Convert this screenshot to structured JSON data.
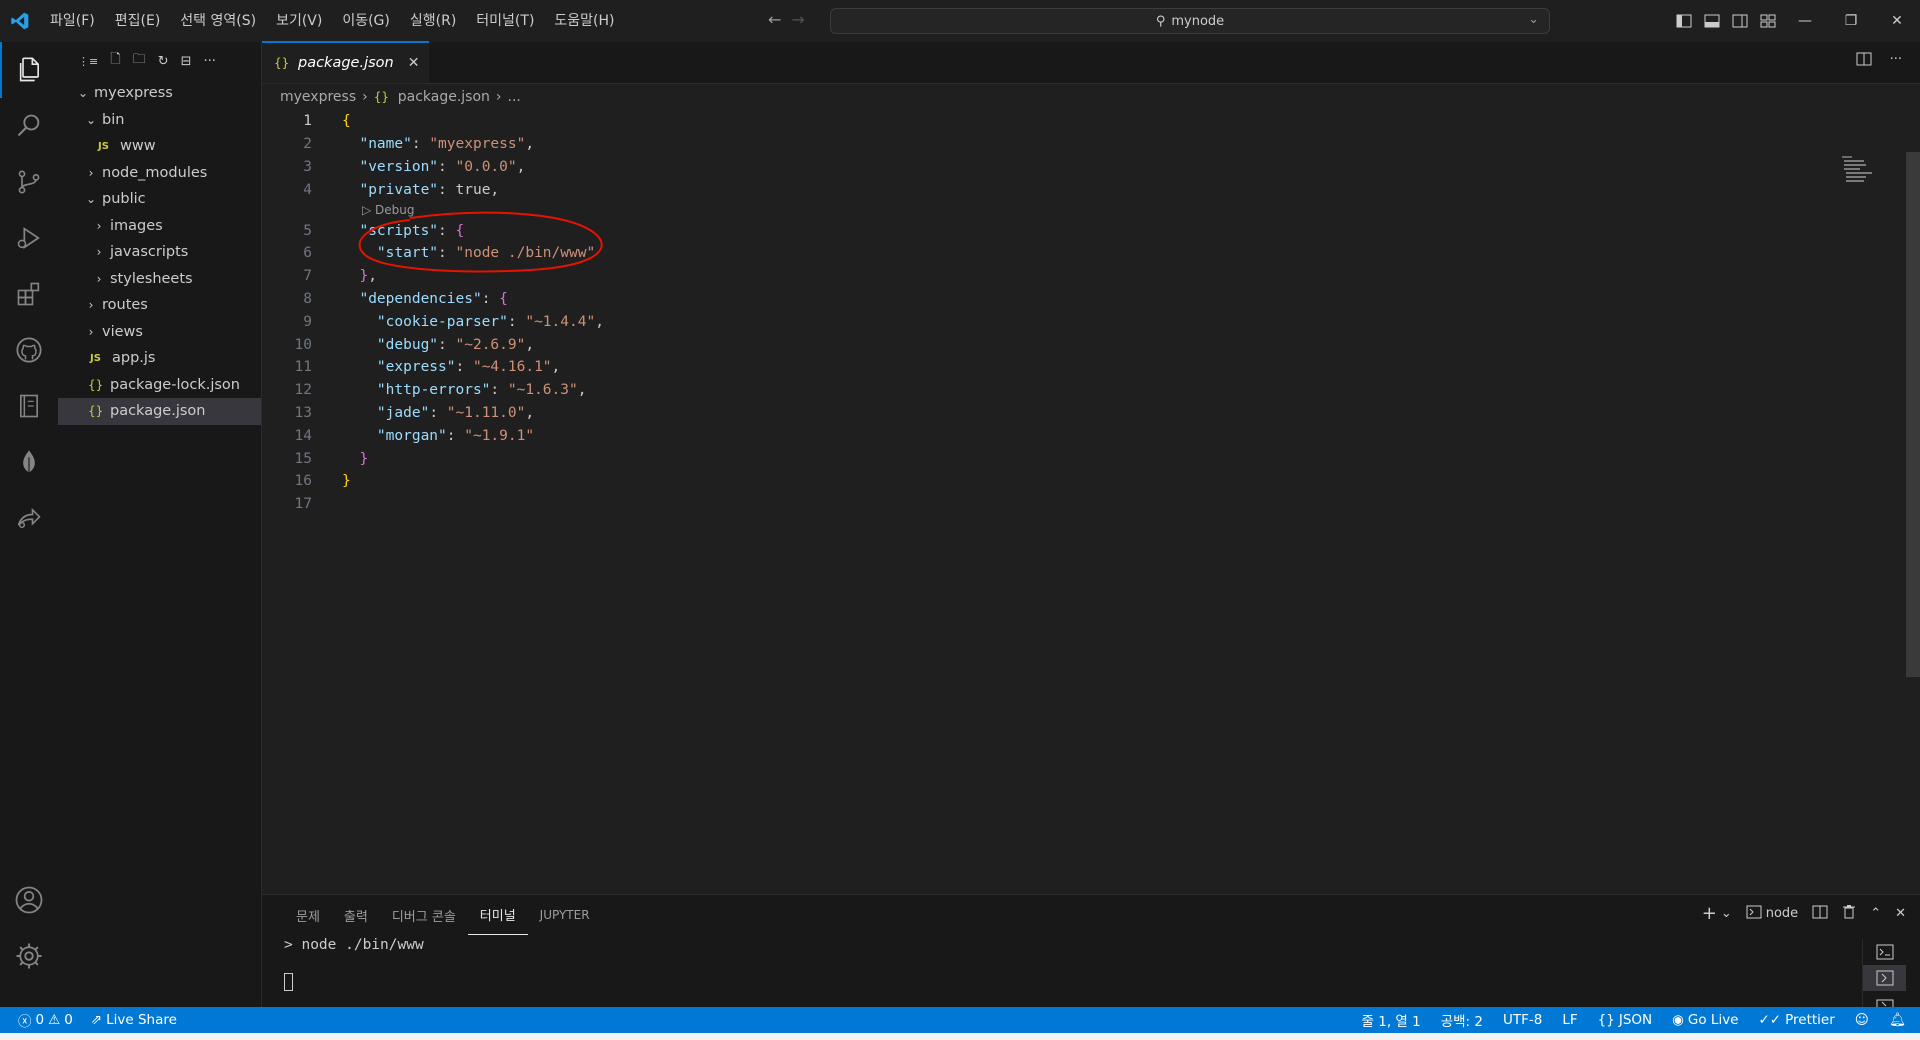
{
  "window": {
    "search_text": "mynode"
  },
  "menu": [
    "파일(F)",
    "편집(E)",
    "선택 영역(S)",
    "보기(V)",
    "이동(G)",
    "실행(R)",
    "터미널(T)",
    "도움말(H)"
  ],
  "explorer": {
    "tree": [
      {
        "label": "myexpress",
        "depth": 0,
        "type": "folder-open"
      },
      {
        "label": "bin",
        "depth": 1,
        "type": "folder-open"
      },
      {
        "label": "www",
        "depth": 2,
        "type": "js"
      },
      {
        "label": "node_modules",
        "depth": 1,
        "type": "folder"
      },
      {
        "label": "public",
        "depth": 1,
        "type": "folder-open"
      },
      {
        "label": "images",
        "depth": 2,
        "type": "folder"
      },
      {
        "label": "javascripts",
        "depth": 2,
        "type": "folder"
      },
      {
        "label": "stylesheets",
        "depth": 2,
        "type": "folder"
      },
      {
        "label": "routes",
        "depth": 1,
        "type": "folder"
      },
      {
        "label": "views",
        "depth": 1,
        "type": "folder"
      },
      {
        "label": "app.js",
        "depth": 1,
        "type": "js"
      },
      {
        "label": "package-lock.json",
        "depth": 1,
        "type": "json"
      },
      {
        "label": "package.json",
        "depth": 1,
        "type": "json",
        "selected": true
      }
    ]
  },
  "editor": {
    "tab_label": "package.json",
    "breadcrumb": [
      "myexpress",
      "package.json",
      "..."
    ],
    "codelens": "▷ Debug",
    "lines": [
      {
        "n": "1",
        "t": "{"
      },
      {
        "n": "2",
        "t": "  \"name\": \"myexpress\","
      },
      {
        "n": "3",
        "t": "  \"version\": \"0.0.0\","
      },
      {
        "n": "4",
        "t": "  \"private\": true,"
      },
      {
        "n": "5",
        "t": "  \"scripts\": {"
      },
      {
        "n": "6",
        "t": "    \"start\": \"node ./bin/www\""
      },
      {
        "n": "7",
        "t": "  },"
      },
      {
        "n": "8",
        "t": "  \"dependencies\": {"
      },
      {
        "n": "9",
        "t": "    \"cookie-parser\": \"~1.4.4\","
      },
      {
        "n": "10",
        "t": "    \"debug\": \"~2.6.9\","
      },
      {
        "n": "11",
        "t": "    \"express\": \"~4.16.1\","
      },
      {
        "n": "12",
        "t": "    \"http-errors\": \"~1.6.3\","
      },
      {
        "n": "13",
        "t": "    \"jade\": \"~1.11.0\","
      },
      {
        "n": "14",
        "t": "    \"morgan\": \"~1.9.1\""
      },
      {
        "n": "15",
        "t": "  }"
      },
      {
        "n": "16",
        "t": "}"
      },
      {
        "n": "17",
        "t": ""
      }
    ]
  },
  "panel": {
    "tabs": [
      "문제",
      "출력",
      "디버그 콘솔",
      "터미널",
      "JUPYTER"
    ],
    "active_tab": "터미널",
    "terminal_name": "node",
    "terminal_line": "> node ./bin/www"
  },
  "statusbar": {
    "errors": "0",
    "warnings": "0",
    "live_share": "Live Share",
    "position": "줄 1, 열 1",
    "spaces": "공백: 2",
    "encoding": "UTF-8",
    "eol": "LF",
    "language": "JSON",
    "go_live": "Go Live",
    "prettier": "Prettier"
  },
  "colors": {
    "accent": "#0078d4",
    "annotation": "#e51400"
  }
}
